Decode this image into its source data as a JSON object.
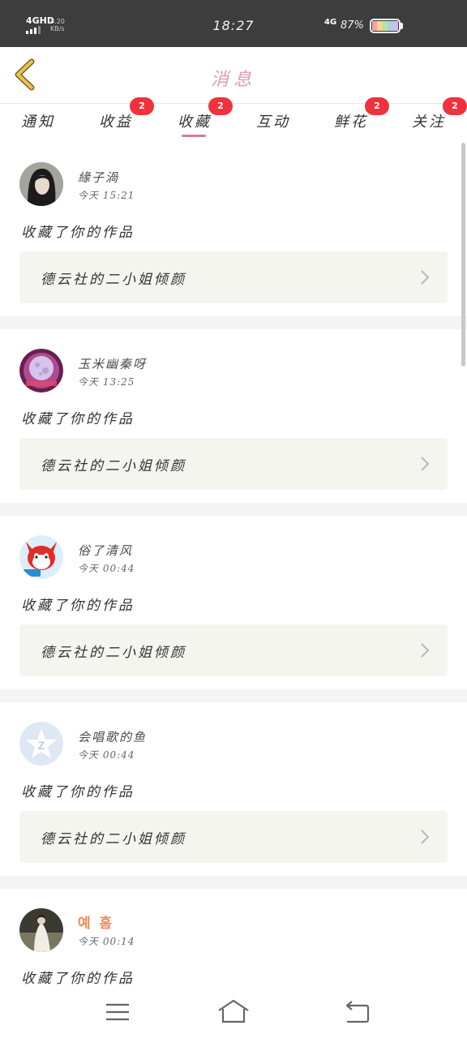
{
  "status_bar": {
    "network": "4GHD",
    "speed_value": "8.20",
    "speed_unit": "KB/s",
    "time": "18:27",
    "network_right": "4G",
    "battery_percent": "87%",
    "battery_colors": [
      "#f2a3a8",
      "#f6d58f",
      "#b8e3a6",
      "#a8cfe6",
      "#d6b8ea"
    ]
  },
  "header": {
    "title": "消息",
    "back_icon": "chevron-left-icon",
    "back_color": "#e0b84a"
  },
  "tabs": [
    {
      "label": "通知",
      "badge": ""
    },
    {
      "label": "收益",
      "badge": "2"
    },
    {
      "label": "收藏",
      "badge": "2",
      "active": true
    },
    {
      "label": "互动",
      "badge": ""
    },
    {
      "label": "鲜花",
      "badge": "2"
    },
    {
      "label": "关注",
      "badge": "2"
    }
  ],
  "accent_color": "#d17a9d",
  "badge_color": "#f0323c",
  "messages": [
    {
      "username": "緣子渦",
      "time": "今天 15:21",
      "action": "收藏了你的作品",
      "work_title": "德云社的二小姐倾颜",
      "avatar": "girl-portrait"
    },
    {
      "username": "玉米幽秦呀",
      "time": "今天 13:25",
      "action": "收藏了你的作品",
      "work_title": "德云社的二小姐倾颜",
      "avatar": "moon-art"
    },
    {
      "username": "俗了清风",
      "time": "今天 00:44",
      "action": "收藏了你的作品",
      "work_title": "德云社的二小姐倾颜",
      "avatar": "red-fox-cartoon"
    },
    {
      "username": "会唱歌的鱼",
      "time": "今天 00:44",
      "action": "收藏了你的作品",
      "work_title": "德云社的二小姐倾颜",
      "avatar": "default-star"
    },
    {
      "username": "예 흠",
      "time": "今天 00:14",
      "action": "收藏了你的作品",
      "work_title": "",
      "avatar": "white-dress-photo"
    }
  ],
  "nav": {
    "menu_icon": "menu-icon",
    "home_icon": "home-icon",
    "back_icon": "back-arrow-icon"
  }
}
